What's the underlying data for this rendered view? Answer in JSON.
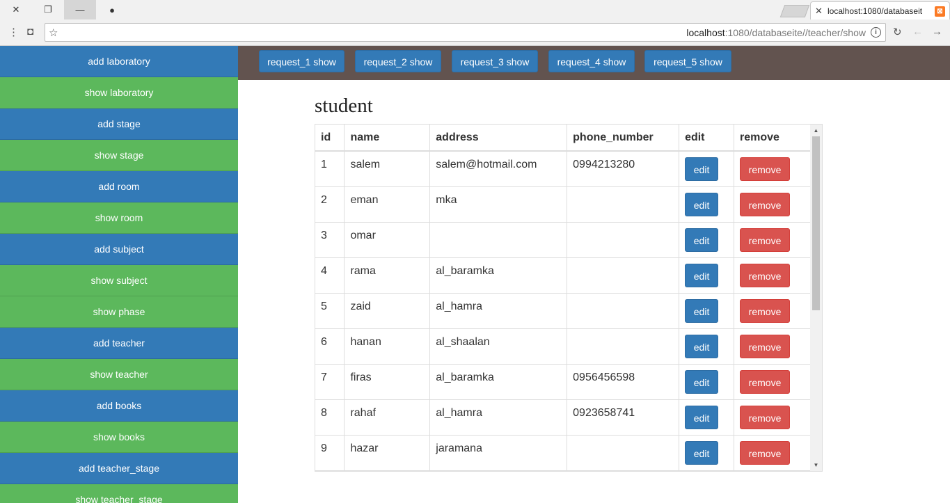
{
  "browser": {
    "tab_title": "localhost:1080/databaseit",
    "url_host": "localhost",
    "url_rest": ":1080/databaseite//teacher/show"
  },
  "sidebar": {
    "items": [
      {
        "label": "add laboratory",
        "color": "blue"
      },
      {
        "label": "show laboratory",
        "color": "green"
      },
      {
        "label": "add stage",
        "color": "blue"
      },
      {
        "label": "show stage",
        "color": "green"
      },
      {
        "label": "add room",
        "color": "blue"
      },
      {
        "label": "show room",
        "color": "green"
      },
      {
        "label": "add subject",
        "color": "blue"
      },
      {
        "label": "show subject",
        "color": "green"
      },
      {
        "label": "show phase",
        "color": "green"
      },
      {
        "label": "add teacher",
        "color": "blue"
      },
      {
        "label": "show teacher",
        "color": "green"
      },
      {
        "label": "add books",
        "color": "blue"
      },
      {
        "label": "show books",
        "color": "green"
      },
      {
        "label": "add teacher_stage",
        "color": "blue"
      },
      {
        "label": "show teacher_stage",
        "color": "green"
      }
    ]
  },
  "topbar": {
    "buttons": [
      "request_1 show",
      "request_2 show",
      "request_3 show",
      "request_4 show",
      "request_5 show"
    ]
  },
  "main": {
    "heading": "student",
    "columns": [
      "id",
      "name",
      "address",
      "phone_number",
      "edit",
      "remove"
    ],
    "edit_label": "edit",
    "remove_label": "remove",
    "rows": [
      {
        "id": "1",
        "name": "salem",
        "address": "salem@hotmail.com",
        "phone": "0994213280"
      },
      {
        "id": "2",
        "name": "eman",
        "address": "mka",
        "phone": ""
      },
      {
        "id": "3",
        "name": "omar",
        "address": "",
        "phone": ""
      },
      {
        "id": "4",
        "name": "rama",
        "address": "al_baramka",
        "phone": ""
      },
      {
        "id": "5",
        "name": "zaid",
        "address": "al_hamra",
        "phone": ""
      },
      {
        "id": "6",
        "name": "hanan",
        "address": "al_shaalan",
        "phone": ""
      },
      {
        "id": "7",
        "name": "firas",
        "address": "al_baramka",
        "phone": "0956456598"
      },
      {
        "id": "8",
        "name": "rahaf",
        "address": "al_hamra",
        "phone": "0923658741"
      },
      {
        "id": "9",
        "name": "hazar",
        "address": "jaramana",
        "phone": ""
      }
    ]
  },
  "colors": {
    "blue": "#337ab7",
    "green": "#5cb85c",
    "red": "#d9534f",
    "topbar": "#62534f"
  }
}
